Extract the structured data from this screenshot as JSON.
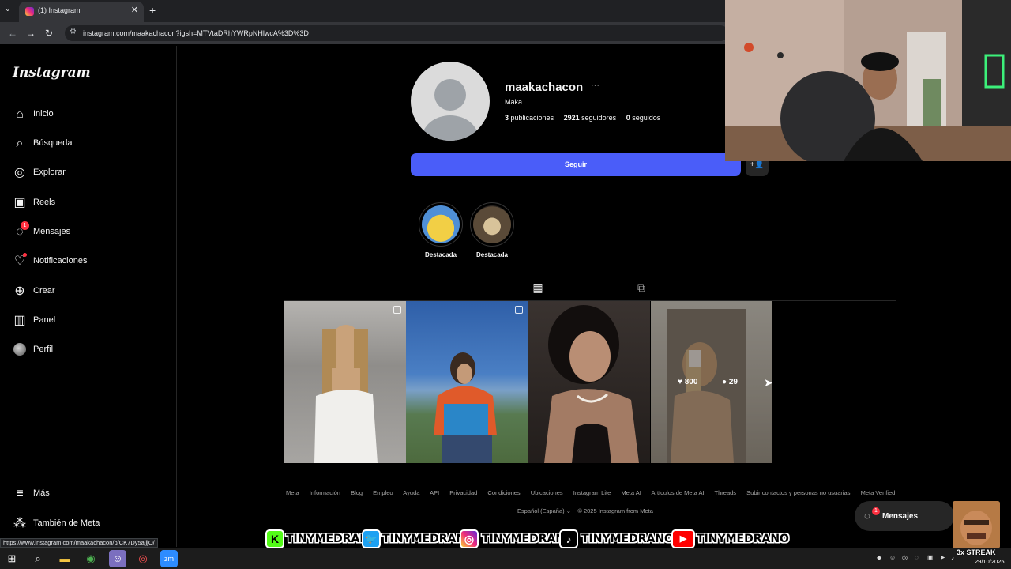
{
  "browser": {
    "tab_title": "(1) Instagram",
    "tab_close": "✕",
    "new_tab": "+",
    "url": "instagram.com/maakachacon?igsh=MTVtaDRhYWRpNHlwcA%3D%3D",
    "status_url": "https://www.instagram.com/maakachacon/p/CK7Dy5ajjjO/"
  },
  "sidebar": {
    "logo": "Instagram",
    "items": [
      {
        "label": "Inicio",
        "icon": "home-icon"
      },
      {
        "label": "Búsqueda",
        "icon": "search-icon"
      },
      {
        "label": "Explorar",
        "icon": "compass-icon"
      },
      {
        "label": "Reels",
        "icon": "reels-icon"
      },
      {
        "label": "Mensajes",
        "icon": "messenger-icon",
        "badge": "1"
      },
      {
        "label": "Notificaciones",
        "icon": "heart-icon"
      },
      {
        "label": "Crear",
        "icon": "plus-square-icon"
      },
      {
        "label": "Panel",
        "icon": "chart-icon"
      },
      {
        "label": "Perfil",
        "icon": "avatar-icon"
      }
    ],
    "more": "Más",
    "also_meta": "También de Meta"
  },
  "profile": {
    "username": "maakachacon",
    "more": "···",
    "full_name": "Maka",
    "posts_count": "3",
    "posts_label": "publicaciones",
    "followers_count": "2921",
    "followers_label": "seguidores",
    "following_count": "0",
    "following_label": "seguidos",
    "follow_button": "Seguir",
    "suggest_icon": "+👤"
  },
  "highlights": [
    {
      "label": "Destacada",
      "color": "#e4c23a"
    },
    {
      "label": "Destacada",
      "color": "#6b5a45"
    }
  ],
  "tabs": [
    {
      "name": "posts",
      "icon": "grid-icon",
      "active": true
    },
    {
      "name": "tagged",
      "icon": "tagged-icon",
      "active": false
    }
  ],
  "posts": [
    {
      "id": "post-1",
      "multi": true,
      "bg": "#9a9a9c"
    },
    {
      "id": "post-2",
      "multi": true,
      "bg": "#3e6aa8"
    },
    {
      "id": "post-3",
      "multi": false,
      "bg": "#2a2422"
    },
    {
      "id": "post-4",
      "multi": true,
      "bg": "#8b8276",
      "hover": true,
      "likes": "800",
      "comments": "29"
    }
  ],
  "footer": {
    "links": [
      "Meta",
      "Información",
      "Blog",
      "Empleo",
      "Ayuda",
      "API",
      "Privacidad",
      "Condiciones",
      "Ubicaciones",
      "Instagram Lite",
      "Meta AI",
      "Artículos de Meta AI",
      "Threads",
      "Subir contactos y personas no usuarias",
      "Meta Verified"
    ],
    "language": "Español (España)",
    "copyright": "© 2025 Instagram from Meta"
  },
  "messages_float": {
    "label": "Mensajes",
    "badge": "1"
  },
  "overlay": {
    "handles": [
      {
        "platform": "kick",
        "icon": "K",
        "handle": "TINYMEDRANO",
        "color": "#53fc18"
      },
      {
        "platform": "twitter",
        "icon": "🐦",
        "handle": "TINYMEDRANO",
        "color": "#1da1f2"
      },
      {
        "platform": "instagram",
        "icon": "◎",
        "handle": "TINYMEDRANO",
        "color": "#d6249f"
      },
      {
        "platform": "tiktok",
        "icon": "♪",
        "handle": "TINYMEDRANOJR",
        "color": "#000000"
      },
      {
        "platform": "youtube",
        "icon": "▶",
        "handle": "TINYMEDRANO",
        "color": "#ff0000"
      }
    ],
    "streak": "3x STREAK"
  },
  "taskbar": {
    "date": "29/10/2025"
  }
}
